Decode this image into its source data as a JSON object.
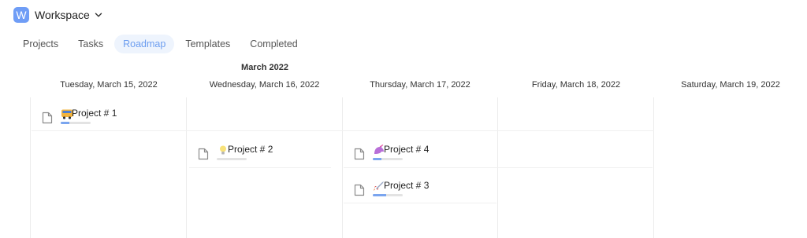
{
  "workspace": {
    "initial": "W",
    "name": "Workspace",
    "dropdown_icon": "chevron-down-icon"
  },
  "tabs": [
    {
      "label": "Projects"
    },
    {
      "label": "Tasks"
    },
    {
      "label": "Roadmap",
      "active": true
    },
    {
      "label": "Templates"
    },
    {
      "label": "Completed"
    }
  ],
  "colors": {
    "accent": "#6d9ef0",
    "logo": "#6f9df6",
    "active_tab_bg": "#eef4fd",
    "progress_fill": "#7aa5ef"
  },
  "roadmap": {
    "month": "March 2022",
    "days": [
      "Tuesday, March 15, 2022",
      "Wednesday, March 16, 2022",
      "Thursday, March 17, 2022",
      "Friday, March 18, 2022",
      "Saturday, March 19, 2022"
    ],
    "projects": [
      {
        "name": "Project # 1",
        "emoji": "bus",
        "progress": 0.3
      },
      {
        "name": "Project # 2",
        "emoji": "lightbulb",
        "progress": 0.0
      },
      {
        "name": "Project # 4",
        "emoji": "unicorn",
        "progress": 0.3
      },
      {
        "name": "Project # 3",
        "emoji": "rocket",
        "progress": 0.45
      }
    ]
  }
}
